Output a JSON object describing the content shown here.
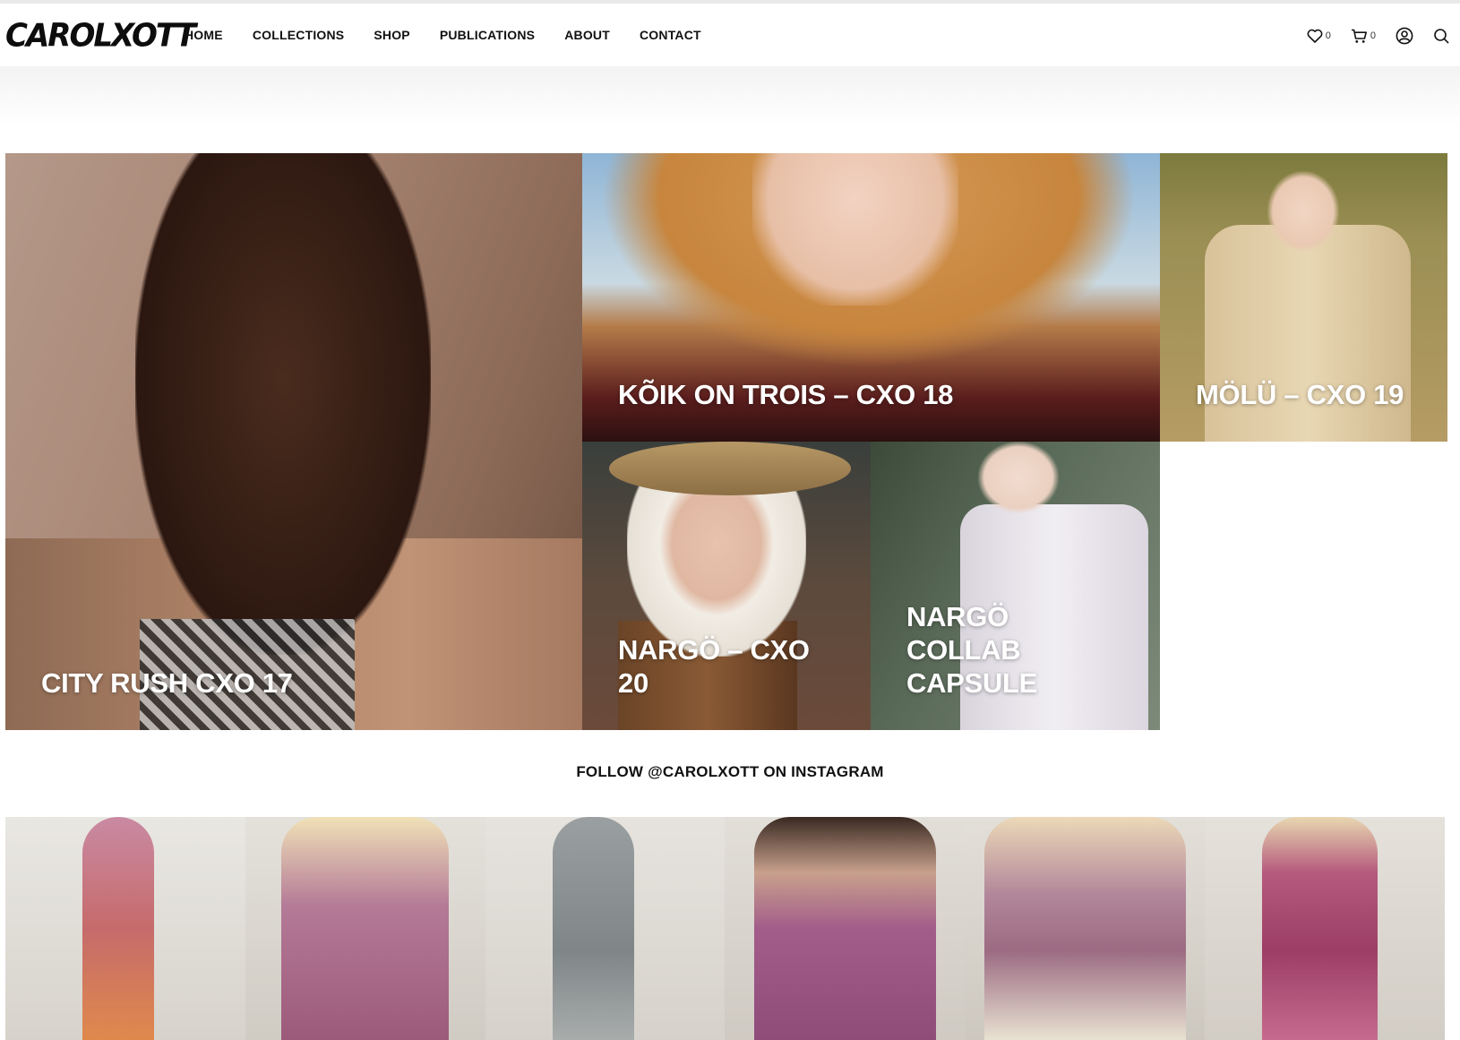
{
  "brand": {
    "logo_text": "CAROLXOTT"
  },
  "nav": {
    "items": [
      "HOME",
      "COLLECTIONS",
      "SHOP",
      "PUBLICATIONS",
      "ABOUT",
      "CONTACT"
    ]
  },
  "header_icons": {
    "wishlist": {
      "icon": "heart-icon",
      "count": "0"
    },
    "cart": {
      "icon": "cart-icon",
      "count": "0"
    },
    "account": {
      "icon": "user-icon"
    },
    "search": {
      "icon": "search-icon"
    }
  },
  "collections": [
    {
      "label": "CITY RUSH CXO 17"
    },
    {
      "label": "KÕIK ON TROIS – CXO 18"
    },
    {
      "label": "MÖLÜ – CXO 19"
    },
    {
      "label": "NARGÖ – CXO 20"
    },
    {
      "label": "NARGÖ COLLAB CAPSULE"
    }
  ],
  "instagram": {
    "heading": "FOLLOW @CAROLXOTT ON INSTAGRAM",
    "posts": 6
  }
}
